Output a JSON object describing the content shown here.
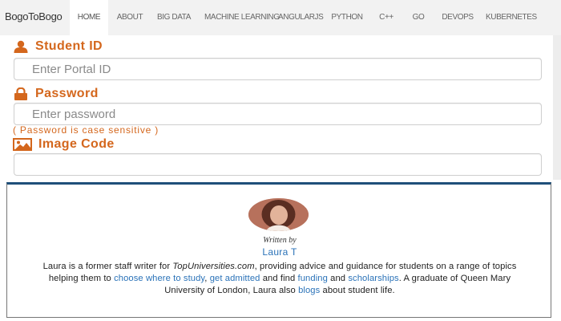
{
  "navbar": {
    "brand": "BogoToBogo",
    "items": [
      {
        "label": "HOME",
        "active": true
      },
      {
        "label": "ABOUT",
        "active": false
      },
      {
        "label": "BIG DATA",
        "active": false
      },
      {
        "label": "MACHINE LEARNING",
        "active": false
      },
      {
        "label": "ANGULARJS",
        "active": false
      },
      {
        "label": "PYTHON",
        "active": false
      },
      {
        "label": "C++",
        "active": false
      },
      {
        "label": "GO",
        "active": false
      },
      {
        "label": "DEVOPS",
        "active": false
      },
      {
        "label": "KUBERNETES",
        "active": false
      }
    ]
  },
  "form": {
    "student_id": {
      "label": "Student ID",
      "placeholder": "Enter Portal ID",
      "value": "",
      "icon": "user-icon"
    },
    "password": {
      "label": "Password",
      "placeholder": "Enter password",
      "value": "",
      "icon": "lock-icon"
    },
    "password_hint": "( Password is case sensitive )",
    "image_code": {
      "label": "Image Code",
      "placeholder": "",
      "value": "",
      "icon": "image-icon"
    },
    "accent_color": "#d4671d"
  },
  "author_card": {
    "written_by": "Written by",
    "name": "Laura T",
    "bio_parts": {
      "p1": "Laura is a former staff writer for ",
      "site": "TopUniversities.com",
      "p2": ", providing advice and guidance for students on a range of topics helping them to ",
      "link_choose": "choose where to study",
      "sep1": ", ",
      "link_admitted": "get admitted",
      "p3": " and find ",
      "link_funding": "funding",
      "p4": " and ",
      "link_scholarships": "scholarships",
      "p5": ". A graduate of Queen Mary University of London, Laura also ",
      "link_blogs": "blogs",
      "p6": " about student life."
    },
    "link_color": "#2a72b8",
    "border_top_color": "#1f4f7a"
  }
}
